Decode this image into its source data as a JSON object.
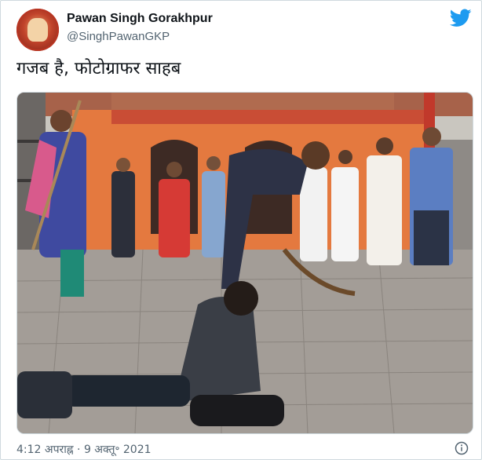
{
  "author": {
    "name": "Pawan Singh Gorakhpur",
    "handle": "@SinghPawanGKP",
    "avatar_icon": "profile-avatar"
  },
  "tweet": {
    "text": "गजब है, फोटोग्राफर साहब",
    "timestamp": "4:12 अपराह्न · 9 अक्तू॰ 2021"
  },
  "icons": {
    "brand": "twitter-bird-icon",
    "info": "info-icon"
  },
  "colors": {
    "brand_blue": "#1d9bf0",
    "text_primary": "#0f1419",
    "text_secondary": "#536471",
    "border": "#cfd9de"
  }
}
